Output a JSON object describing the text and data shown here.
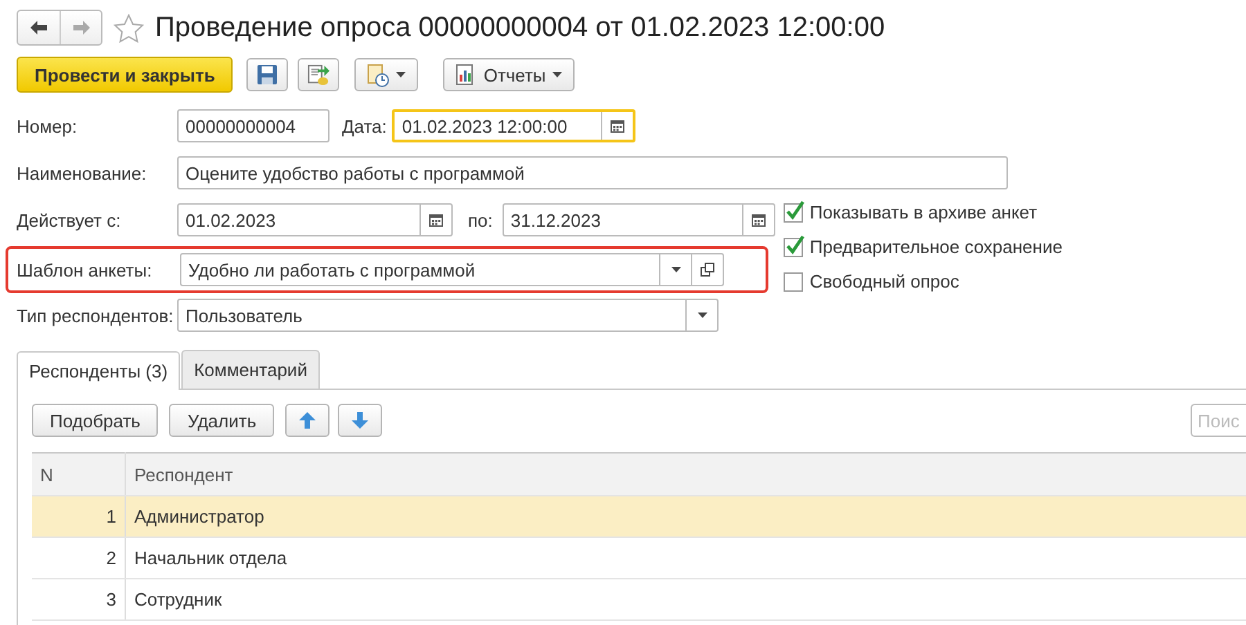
{
  "title": "Проведение опроса 00000000004 от 01.02.2023 12:00:00",
  "favorite": false,
  "toolbar": {
    "primary": "Провести и закрыть",
    "reports": "Отчеты"
  },
  "number": {
    "label": "Номер:",
    "value": "00000000004"
  },
  "date": {
    "label": "Дата:",
    "value": "01.02.2023 12:00:00",
    "focused": true
  },
  "name": {
    "label": "Наименование:",
    "value": "Оцените удобство работы с программой"
  },
  "period": {
    "label": "Действует с:",
    "from": "01.02.2023",
    "to_label": "по:",
    "to": "31.12.2023"
  },
  "template": {
    "label": "Шаблон анкеты:",
    "value": "Удобно ли работать с программой",
    "highlighted": true
  },
  "respondent_type": {
    "label": "Тип респондентов:",
    "value": "Пользователь"
  },
  "options": [
    {
      "label": "Показывать в архиве анкет",
      "checked": true
    },
    {
      "label": "Предварительное сохранение",
      "checked": true
    },
    {
      "label": "Свободный опрос",
      "checked": false
    }
  ],
  "tabs": [
    {
      "label": "Респонденты (3)",
      "selected": true
    },
    {
      "label": "Комментарий",
      "selected": false
    }
  ],
  "table_buttons": [
    "Подобрать",
    "Удалить"
  ],
  "search": {
    "placeholder": "Поис"
  },
  "table": {
    "columns": [
      "N",
      "Респондент"
    ],
    "rows": [
      {
        "n": "1",
        "name": "Администратор",
        "selected": true
      },
      {
        "n": "2",
        "name": "Начальник отдела",
        "selected": false
      },
      {
        "n": "3",
        "name": "Сотрудник",
        "selected": false
      }
    ]
  }
}
